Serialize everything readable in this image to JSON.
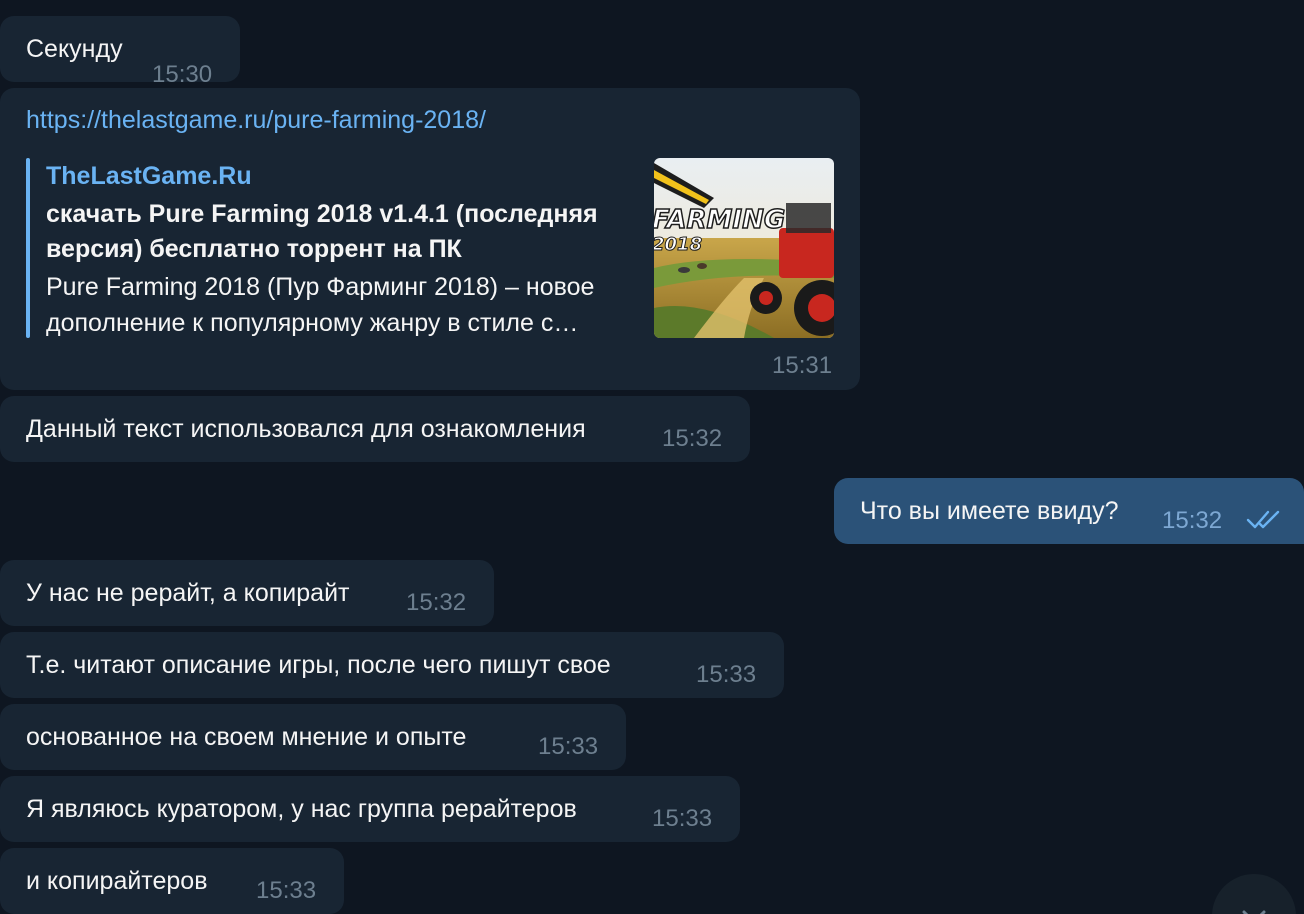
{
  "messages": [
    {
      "text": "Секунду",
      "time": "15:30",
      "direction": "in"
    },
    {
      "link": "https://thelastgame.ru/pure-farming-2018/",
      "preview": {
        "site": "TheLastGame.Ru",
        "title": "скачать Pure Farming 2018 v1.4.1 (последняя версия) бесплатно торрент на ПК",
        "desc_line1": "Pure Farming 2018 (Пур Фарминг 2018) – новое",
        "desc_line2": "дополнение к популярному жанру в стиле с…",
        "image_text_line1": "FARMING",
        "image_text_line2": "2018"
      },
      "time": "15:31",
      "direction": "in"
    },
    {
      "text": "Данный текст использовался для ознакомления",
      "time": "15:32",
      "direction": "in"
    },
    {
      "text": "Что вы имеете ввиду?",
      "time": "15:32",
      "direction": "out",
      "status": "read-double-check"
    },
    {
      "text": "У нас не рерайт, а копирайт",
      "time": "15:32",
      "direction": "in"
    },
    {
      "text": "Т.е. читают описание игры, после чего пишут свое",
      "time": "15:33",
      "direction": "in"
    },
    {
      "text": "основанное на своем мнение и опыте",
      "time": "15:33",
      "direction": "in"
    },
    {
      "text": "Я являюсь куратором, у нас группа рерайтеров",
      "time": "15:33",
      "direction": "in"
    },
    {
      "text": "и копирайтеров",
      "time": "15:33",
      "direction": "in"
    }
  ],
  "colors": {
    "background": "#0e1621",
    "incoming_bubble": "#182533",
    "outgoing_bubble": "#2b5278",
    "link": "#6ab3f3",
    "time_in": "#6d7f8f",
    "time_out": "#7da8d3"
  },
  "icons": {
    "read_status": "double-check-icon",
    "scroll_down": "chevron-down-icon"
  }
}
